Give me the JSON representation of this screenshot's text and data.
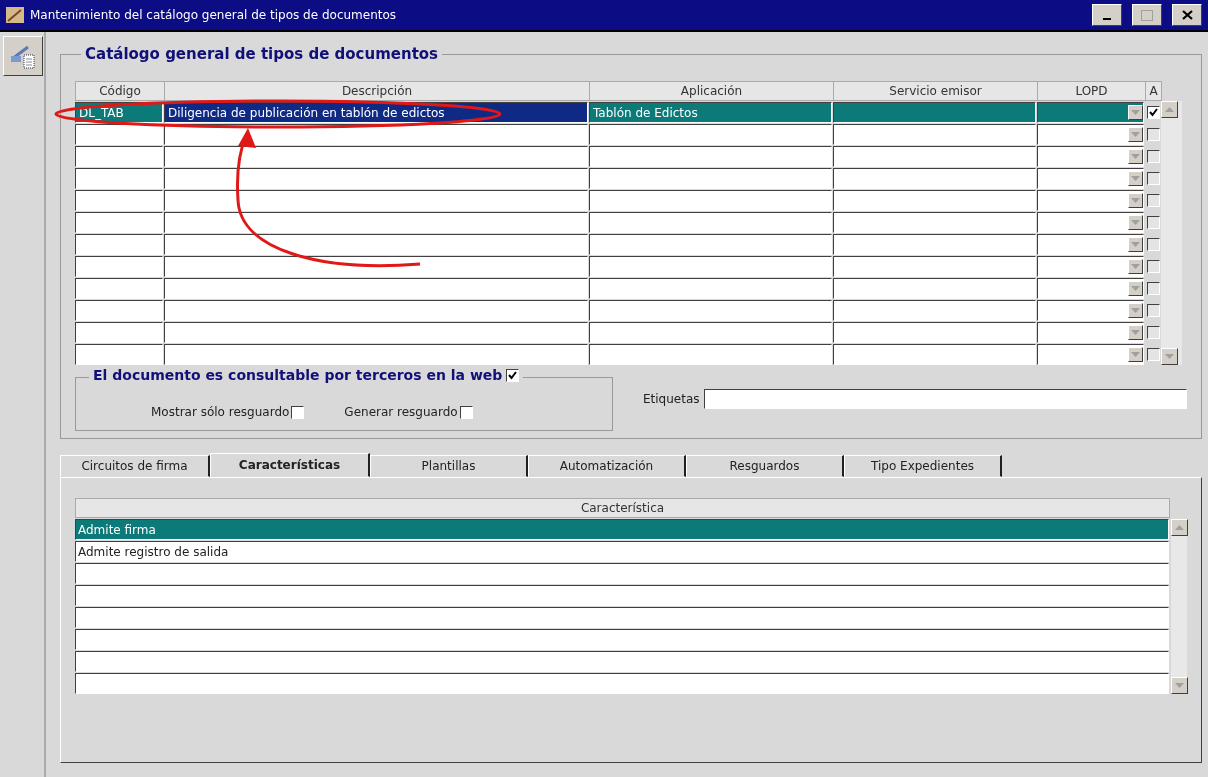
{
  "window": {
    "title": "Mantenimiento del catálogo general de tipos de documentos"
  },
  "catalog": {
    "title": "Catálogo general de tipos de documentos",
    "columns": [
      "Código",
      "Descripción",
      "Aplicación",
      "Servicio emisor",
      "LOPD",
      "A"
    ],
    "rows": [
      {
        "code": "DL_TAB",
        "description": "Diligencia de publicación en tablón de edictos",
        "application": "Tablón de Edictos",
        "selected": true,
        "checked": true
      },
      {
        "selected": false,
        "checked": false
      },
      {
        "selected": false,
        "checked": false
      },
      {
        "selected": false,
        "checked": false
      },
      {
        "selected": false,
        "checked": false
      },
      {
        "selected": false,
        "checked": false
      },
      {
        "selected": false,
        "checked": false
      },
      {
        "selected": false,
        "checked": false
      },
      {
        "selected": false,
        "checked": false
      },
      {
        "selected": false,
        "checked": false
      },
      {
        "selected": false,
        "checked": false
      },
      {
        "selected": false,
        "checked": false
      }
    ]
  },
  "web": {
    "title": "El documento es consultable por terceros en la web",
    "checked": true,
    "options": [
      {
        "label": "Mostrar sólo resguardo",
        "checked": false
      },
      {
        "label": "Generar resguardo",
        "checked": false
      }
    ]
  },
  "tags": {
    "label": "Etiquetas"
  },
  "tabs": [
    {
      "label": "Circuitos de firma",
      "selected": false
    },
    {
      "label": "Características",
      "selected": true
    },
    {
      "label": "Plantillas",
      "selected": false
    },
    {
      "label": "Automatización",
      "selected": false
    },
    {
      "label": "Resguardos",
      "selected": false
    },
    {
      "label": "Tipo Expedientes",
      "selected": false
    }
  ],
  "features": {
    "column": "Característica",
    "rows": [
      {
        "text": "Admite firma",
        "selected": true
      },
      {
        "text": "Admite registro de salida",
        "selected": false
      },
      {
        "selected": false
      },
      {
        "selected": false
      },
      {
        "selected": false
      },
      {
        "selected": false
      },
      {
        "selected": false
      },
      {
        "selected": false
      }
    ]
  }
}
